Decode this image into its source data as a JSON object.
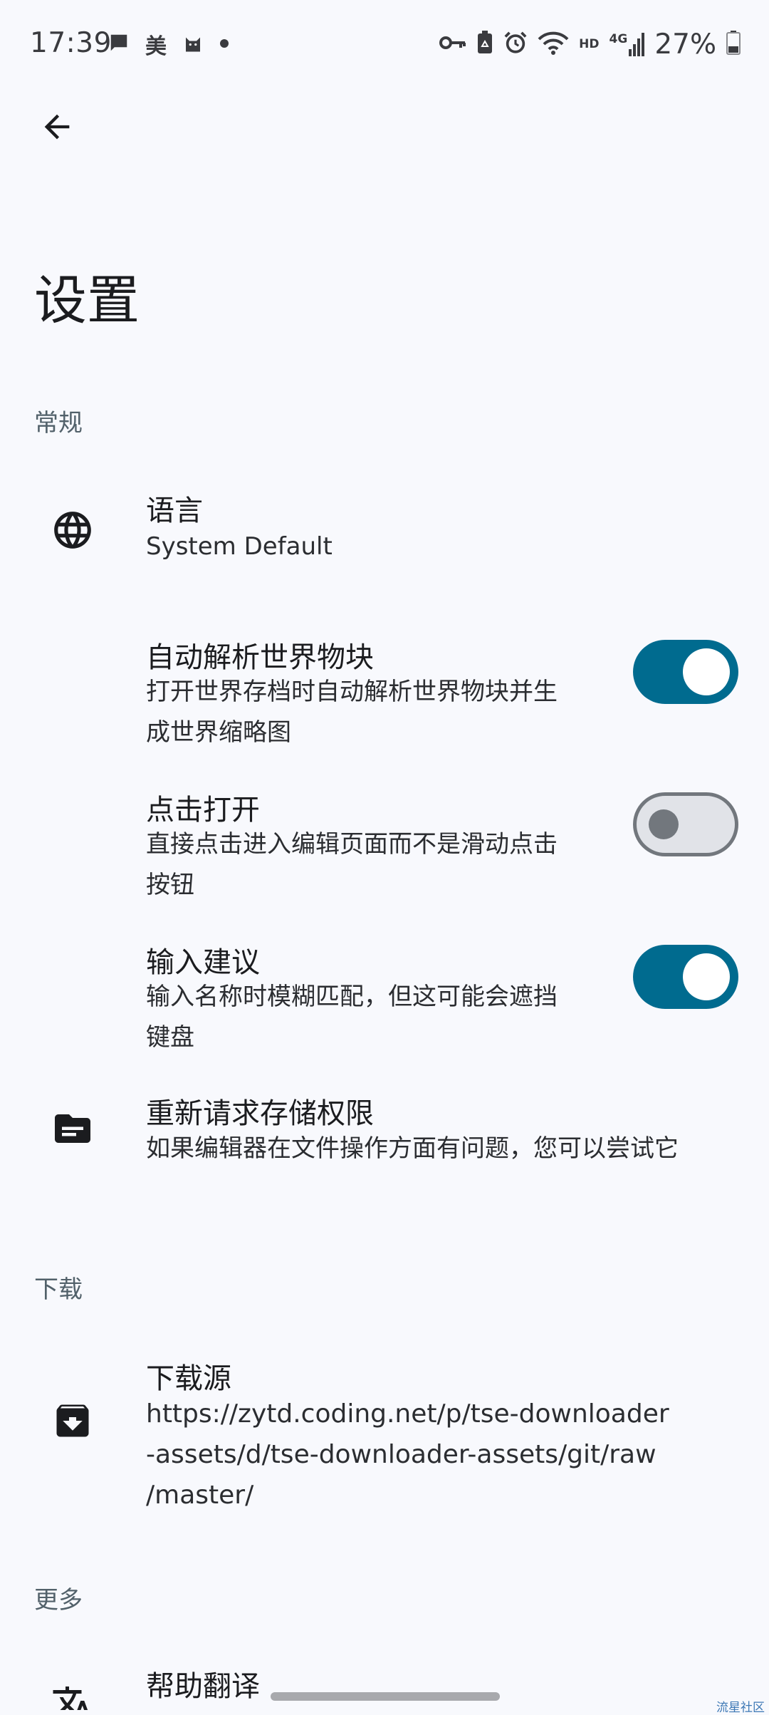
{
  "status_bar": {
    "time": "17:39",
    "left_text_icon": "美",
    "network_label": "HD",
    "network_gen": "4G",
    "battery": "27%",
    "icons": [
      "chat-bubble-icon",
      "cat-icon",
      "dot-icon",
      "key-icon",
      "recycle-battery-icon",
      "alarm-icon",
      "wifi-icon",
      "signal-icon",
      "battery-icon"
    ]
  },
  "app_bar": {
    "back_icon": "arrow-back-icon"
  },
  "page": {
    "title": "设置"
  },
  "sections": {
    "general": {
      "header": "常规",
      "language": {
        "title": "语言",
        "value": "System Default",
        "icon": "globe-icon"
      },
      "auto_parse": {
        "title": "自动解析世界物块",
        "desc_line1": "打开世界存档时自动解析世界物块并生",
        "desc_line2": "成世界缩略图",
        "enabled": true
      },
      "tap_open": {
        "title": "点击打开",
        "desc_line1": "直接点击进入编辑页面而不是滑动点击",
        "desc_line2": "按钮",
        "enabled": false
      },
      "input_suggest": {
        "title": "输入建议",
        "desc_line1": "输入名称时模糊匹配，但这可能会遮挡",
        "desc_line2": "键盘",
        "enabled": true
      },
      "storage_permission": {
        "title": "重新请求存储权限",
        "desc": "如果编辑器在文件操作方面有问题，您可以尝试它",
        "icon": "folder-icon"
      }
    },
    "download": {
      "header": "下载",
      "source": {
        "title": "下载源",
        "url_line1": "https://zytd.coding.net/p/tse-downloader",
        "url_line2": "-assets/d/tse-downloader-assets/git/raw",
        "url_line3": "/master/",
        "icon": "archive-download-icon"
      }
    },
    "more": {
      "header": "更多",
      "translate": {
        "title": "帮助翻译",
        "icon": "translate-icon"
      }
    }
  },
  "watermark": "流星社区",
  "colors": {
    "background": "#f8f9fd",
    "switch_on": "#006b8f",
    "switch_off_track": "#e1e3e8",
    "switch_off_outline": "#72777d",
    "section_header": "#52616a"
  }
}
